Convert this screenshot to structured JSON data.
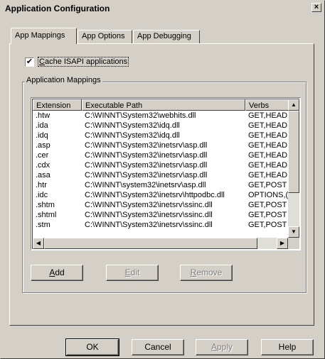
{
  "window": {
    "title": "Application Configuration",
    "close_glyph": "×"
  },
  "tabs": [
    {
      "label": "App Mappings",
      "active": true
    },
    {
      "label": "App Options",
      "active": false
    },
    {
      "label": "App Debugging",
      "active": false
    }
  ],
  "cache_checkbox": {
    "checked": true,
    "label_pre": "",
    "accel": "C",
    "label_post": "ache ISAPI applications"
  },
  "mappings_group": {
    "label": "Application Mappings",
    "columns": [
      "Extension",
      "Executable Path",
      "Verbs"
    ],
    "rows": [
      [
        ".htw",
        "C:\\WINNT\\System32\\webhits.dll",
        "GET,HEAD"
      ],
      [
        ".ida",
        "C:\\WINNT\\System32\\idq.dll",
        "GET,HEAD"
      ],
      [
        ".idq",
        "C:\\WINNT\\System32\\idq.dll",
        "GET,HEAD"
      ],
      [
        ".asp",
        "C:\\WINNT\\System32\\inetsrv\\asp.dll",
        "GET,HEAD"
      ],
      [
        ".cer",
        "C:\\WINNT\\System32\\inetsrv\\asp.dll",
        "GET,HEAD"
      ],
      [
        ".cdx",
        "C:\\WINNT\\System32\\inetsrv\\asp.dll",
        "GET,HEAD"
      ],
      [
        ".asa",
        "C:\\WINNT\\System32\\inetsrv\\asp.dll",
        "GET,HEAD"
      ],
      [
        ".htr",
        "C:\\WINNT\\system32\\inetsrv\\asp.dll",
        "GET,POST"
      ],
      [
        ".idc",
        "C:\\WINNT\\System32\\inetsrv\\httpodbc.dll",
        "OPTIONS,("
      ],
      [
        ".shtm",
        "C:\\WINNT\\System32\\inetsrv\\ssinc.dll",
        "GET,POST"
      ],
      [
        ".shtml",
        "C:\\WINNT\\System32\\inetsrv\\ssinc.dll",
        "GET,POST"
      ],
      [
        ".stm",
        "C:\\WINNT\\System32\\inetsrv\\ssinc.dll",
        "GET,POST"
      ]
    ],
    "buttons": {
      "add": {
        "accel": "A",
        "rest": "dd",
        "enabled": true
      },
      "edit": {
        "accel": "E",
        "rest": "dit",
        "enabled": false
      },
      "remove": {
        "accel": "R",
        "rest": "emove",
        "enabled": false
      }
    }
  },
  "footer": {
    "ok": "OK",
    "cancel": "Cancel",
    "apply": {
      "accel": "A",
      "rest": "pply",
      "enabled": false
    },
    "help": "Help"
  },
  "icons": {
    "checkmark": "✔",
    "scroll_up": "▲",
    "scroll_down": "▼",
    "scroll_left": "◀",
    "scroll_right": "▶"
  }
}
